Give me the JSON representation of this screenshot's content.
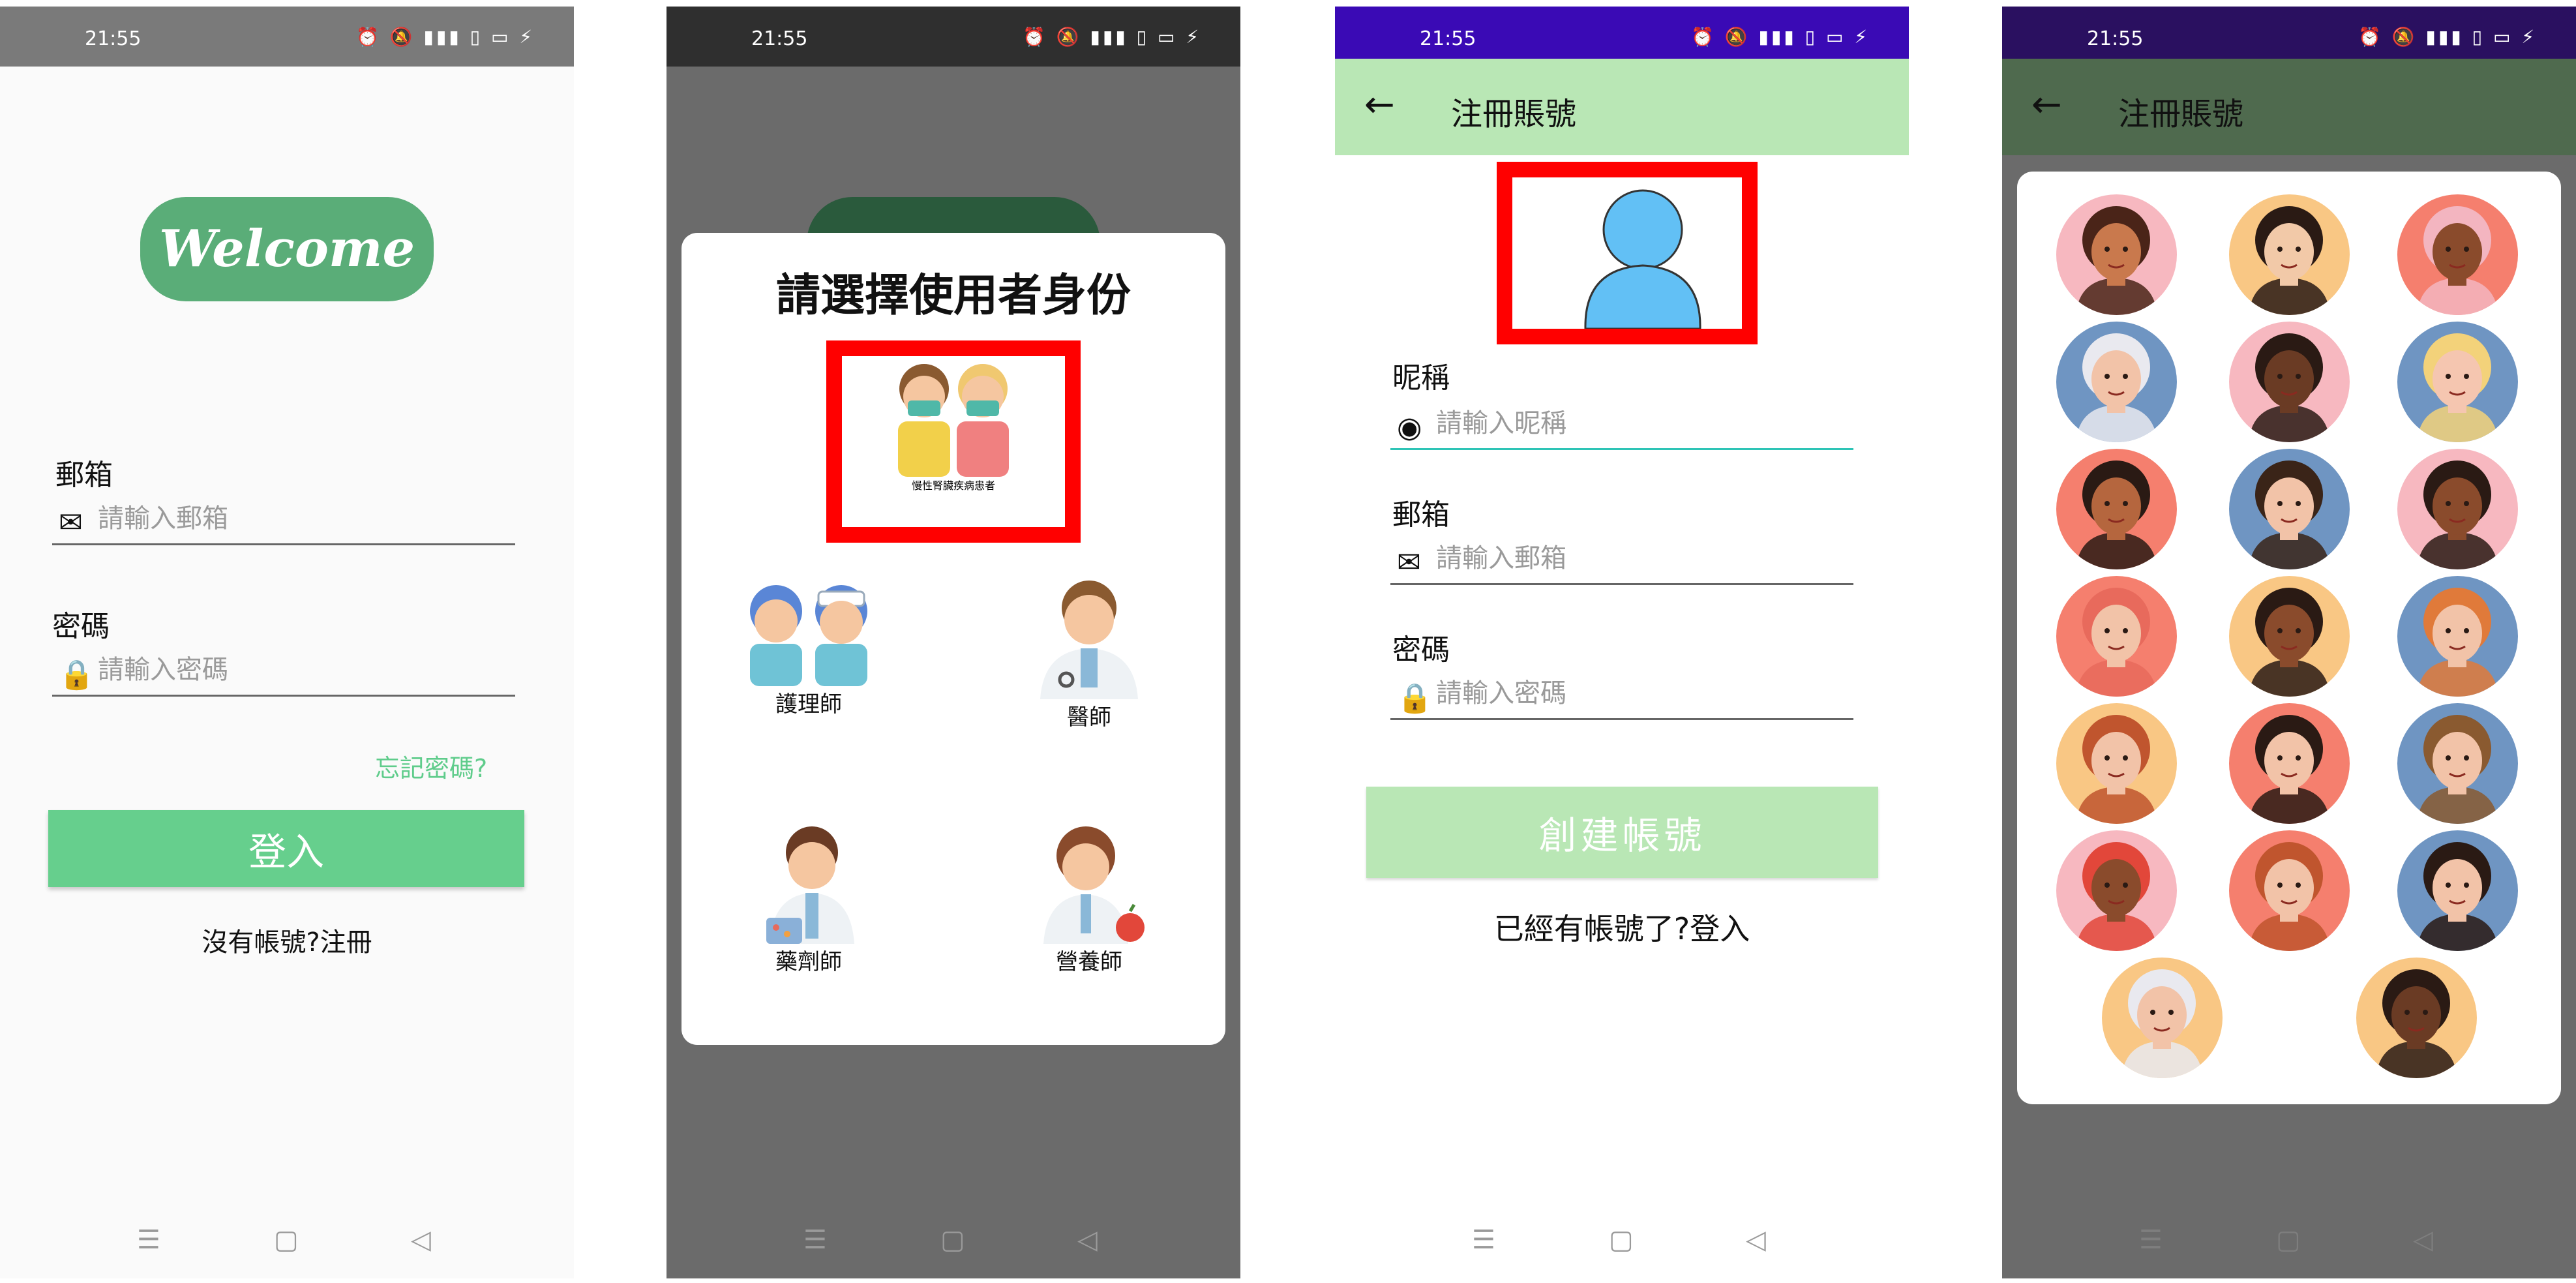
{
  "status_bar": {
    "time": "21:55",
    "icons": "⏰ 🔕 ▮▮▮ ▯ ▭ ⚡"
  },
  "nav_bar": {
    "menu": "☰",
    "home": "▢",
    "back": "◁"
  },
  "login": {
    "logo": "Welcome",
    "email_label": "郵箱",
    "email_placeholder": "請輸入郵箱",
    "password_label": "密碼",
    "password_placeholder": "請輸入密碼",
    "forgot": "忘記密碼?",
    "login_button": "登入",
    "register_link": "沒有帳號?注冊"
  },
  "role_dialog": {
    "title": "請選擇使用者身份",
    "roles": [
      {
        "label": "慢性腎臟疾病患者",
        "selected": true
      },
      {
        "label": "護理師"
      },
      {
        "label": "醫師"
      },
      {
        "label": "藥劑師"
      },
      {
        "label": "營養師"
      }
    ]
  },
  "register": {
    "back": "←",
    "title": "注冊賬號",
    "nickname_label": "昵稱",
    "nickname_placeholder": "請輸入昵稱",
    "email_label": "郵箱",
    "email_placeholder": "請輸入郵箱",
    "password_label": "密碼",
    "password_placeholder": "請輸入密碼",
    "create_button": "創建帳號",
    "login_link": "已經有帳號了?登入"
  },
  "avatar_picker": {
    "back": "←",
    "title": "注冊賬號",
    "avatars": [
      {
        "bg": "#f7b8c0",
        "skin": "#c9794d",
        "hair": "#4a2418"
      },
      {
        "bg": "#f9c784",
        "skin": "#f2c9a8",
        "hair": "#2a1a14"
      },
      {
        "bg": "#f57f6e",
        "skin": "#8a4b2c",
        "hair": "#f3b5c0"
      },
      {
        "bg": "#6f95c2",
        "skin": "#f2c3a8",
        "hair": "#e9e9ef"
      },
      {
        "bg": "#f7b8c0",
        "skin": "#6a3b24",
        "hair": "#2a1a14"
      },
      {
        "bg": "#6f95c2",
        "skin": "#f5c6b0",
        "hair": "#f3d27a"
      },
      {
        "bg": "#f57f6e",
        "skin": "#b5663e",
        "hair": "#2a1a14"
      },
      {
        "bg": "#6f95c2",
        "skin": "#f2c3a8",
        "hair": "#3a2418"
      },
      {
        "bg": "#f7b8c0",
        "skin": "#8a4b2c",
        "hair": "#2a1a14"
      },
      {
        "bg": "#f57f6e",
        "skin": "#f2c3a8",
        "hair": "#e86a5c"
      },
      {
        "bg": "#f9c784",
        "skin": "#8a4b2c",
        "hair": "#2a1a14"
      },
      {
        "bg": "#6f95c2",
        "skin": "#f2c3a8",
        "hair": "#e07a3a"
      },
      {
        "bg": "#f9c784",
        "skin": "#f2c3a8",
        "hair": "#c0552e"
      },
      {
        "bg": "#f57f6e",
        "skin": "#f2c3a8",
        "hair": "#2a1a14"
      },
      {
        "bg": "#6f95c2",
        "skin": "#f2c3a8",
        "hair": "#8a5a30"
      },
      {
        "bg": "#f7b8c0",
        "skin": "#8a4b2c",
        "hair": "#e2473a"
      },
      {
        "bg": "#f57f6e",
        "skin": "#f2c3a8",
        "hair": "#c0552e"
      },
      {
        "bg": "#6f95c2",
        "skin": "#f2c3a8",
        "hair": "#2a1a14"
      },
      {
        "bg": "#f9c784",
        "skin": "#f2c3a8",
        "hair": "#e9e9ef"
      },
      {
        "bg": "#f9c784",
        "skin": "#6a3b24",
        "hair": "#2a1a14"
      }
    ]
  },
  "colors": {
    "accent_green": "#66cf8d",
    "light_green": "#b9e7b5",
    "selection_red": "#ff0000",
    "default_avatar": "#62c0f5"
  }
}
